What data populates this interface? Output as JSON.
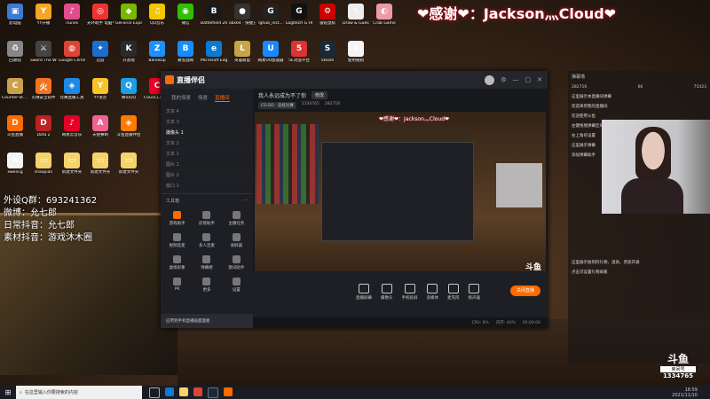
{
  "overlay": {
    "title": "❤感谢❤：Jackson灬Cloud❤",
    "left_info": [
      "外设Q群：693241362",
      "微博：允七郎",
      "日常抖音：允七郎",
      "素材抖音：游戏沐木圈"
    ]
  },
  "desktop_icons": [
    {
      "label": "此电脑",
      "color": "#3a7bd5",
      "glyph": "▣"
    },
    {
      "label": "YY开播",
      "color": "#f5a623",
      "glyph": "Y"
    },
    {
      "label": "iTunes",
      "color": "#e14d8a",
      "glyph": "♪"
    },
    {
      "label": "光环助手 电脑平台",
      "color": "#e33",
      "glyph": "◎"
    },
    {
      "label": "GeForce Experience",
      "color": "#76b900",
      "glyph": "◆"
    },
    {
      "label": "QQ音乐",
      "color": "#f3c600",
      "glyph": "♫"
    },
    {
      "label": "微信",
      "color": "#2dc100",
      "glyph": "◉"
    },
    {
      "label": "Battlefield 2042 Open",
      "color": "#1a1a1a",
      "glyph": "B"
    },
    {
      "label": "obs64 - 快捷方式",
      "color": "#333",
      "glyph": "●"
    },
    {
      "label": "lghub_inst...",
      "color": "#222",
      "glyph": "G"
    },
    {
      "label": "Logitech G HUB",
      "color": "#111",
      "glyph": "G"
    },
    {
      "label": "雷蛇鼠标",
      "color": "#c00",
      "glyph": "⚙"
    },
    {
      "label": "Draw & Guess",
      "color": "#eee",
      "glyph": "✎"
    },
    {
      "label": "Crab Game",
      "color": "#e9a",
      "glyph": "◐"
    },
    {
      "label": "回收站",
      "color": "#888",
      "glyph": "♻"
    },
    {
      "label": "Sword The Wire Sour...",
      "color": "#444",
      "glyph": "⚔"
    },
    {
      "label": "Google Chrome",
      "color": "#db4437",
      "glyph": "◍"
    },
    {
      "label": "迅游",
      "color": "#1c6dd0",
      "glyph": "✦"
    },
    {
      "label": "开黑啦",
      "color": "#2a2a2a",
      "glyph": "K"
    },
    {
      "label": "Bandizip",
      "color": "#1e90ff",
      "glyph": "Z"
    },
    {
      "label": "暴雪战网",
      "color": "#148eff",
      "glyph": "B"
    },
    {
      "label": "Microsoft Edge",
      "color": "#0a7bd4",
      "glyph": "e"
    },
    {
      "label": "英雄联盟",
      "color": "#c8a448",
      "glyph": "L"
    },
    {
      "label": "网易UU加速器",
      "color": "#1a88ff",
      "glyph": "U"
    },
    {
      "label": "5E对战平台",
      "color": "#d33",
      "glyph": "5"
    },
    {
      "label": "Steam",
      "color": "#1b2838",
      "glyph": "S"
    },
    {
      "label": "使用规则",
      "color": "#f4f4f4",
      "glyph": "≡"
    },
    {
      "label": "Counter-St... Global Off...",
      "color": "#c9a24a",
      "glyph": "C"
    },
    {
      "label": "火绒安全软件",
      "color": "#f47321",
      "glyph": "火"
    },
    {
      "label": "比赛直播工具",
      "color": "#1e88e5",
      "glyph": "◈"
    },
    {
      "label": "YY语音",
      "color": "#f8c32b",
      "glyph": "Y"
    },
    {
      "label": "腾讯QQ",
      "color": "#18a0e8",
      "glyph": "Q"
    },
    {
      "label": "CSGO工具箱 5.5.8 (5)",
      "color": "#e02",
      "glyph": "C"
    },
    {
      "label": "斗鱼直播",
      "color": "#ff6a00",
      "glyph": "D"
    },
    {
      "label": "Dota 2",
      "color": "#b22",
      "glyph": "D"
    },
    {
      "label": "网易云音乐",
      "color": "#e60026",
      "glyph": "♪"
    },
    {
      "label": "天使赛制",
      "color": "#f06292",
      "glyph": "A"
    },
    {
      "label": "斗鱼直播伴侣",
      "color": "#ff7a00",
      "glyph": "◈"
    },
    {
      "label": "xwencg",
      "color": "#f4f4f4",
      "glyph": "≡"
    },
    {
      "label": "shaopian",
      "color": "#f5d36b",
      "glyph": "▭"
    },
    {
      "label": "新建文件夹",
      "color": "#f5d36b",
      "glyph": "▭"
    },
    {
      "label": "新建文件夹",
      "color": "#f5d36b",
      "glyph": "▭"
    },
    {
      "label": "新建文件夹",
      "color": "#f5d36b",
      "glyph": "▭"
    }
  ],
  "app": {
    "name": "直播伴侣",
    "tabs": [
      "我的场景",
      "场景",
      "直播间"
    ],
    "active_tab": "直播间",
    "scene_items": [
      "文本 4",
      "文本 3",
      "摄像头 1",
      "文本 2",
      "文本 1",
      "图片 1",
      "图片 2",
      "窗口 1"
    ],
    "toolbox_title": "工具箱",
    "tools": [
      "游戏助手",
      "房管助手",
      "主播任务",
      "视频连麦",
      "多人连麦",
      "录屏器",
      "虚拟形象",
      "弹幕姬",
      "歌词助手",
      "PK",
      "更多",
      "设置"
    ],
    "notice": "应用到手机直播画面面板",
    "stream_title": "我人永远成为不了你",
    "modify_label": "修改",
    "category": "CS:GO · 竞技比赛",
    "stats": {
      "fans": "1334765",
      "heat": "282716"
    },
    "preview_title": "❤感谢❤：Jackson灬Cloud❤",
    "controls": [
      "直播屏幕",
      "摄像头",
      "手机投屏",
      "多媒体",
      "麦克风",
      "扬声器"
    ],
    "golive": "关闭直播",
    "status": [
      "CPU: 8%",
      "内存: 40%",
      "00:00:00"
    ]
  },
  "right_panel": {
    "header": "弹幕墙",
    "stats": [
      "282716",
      "66",
      "75423"
    ],
    "messages": [
      "这里展示本直播间弹幕",
      "欢迎来到我的直播间",
      "欢迎使用斗鱼",
      "左键拖拽弹幕区域",
      "右上角有设置",
      "这里展示弹幕",
      "添加弹幕助手",
      "这里展示收到的礼物、道具、贵族开通",
      "点击可设置礼物屏蔽"
    ]
  },
  "badge": {
    "brand": "斗鱼",
    "sub": "房间号",
    "room": "1334765"
  },
  "taskbar": {
    "search_placeholder": "在这里输入你要搜索的内容",
    "time": "18:59",
    "date": "2021/11/10"
  }
}
